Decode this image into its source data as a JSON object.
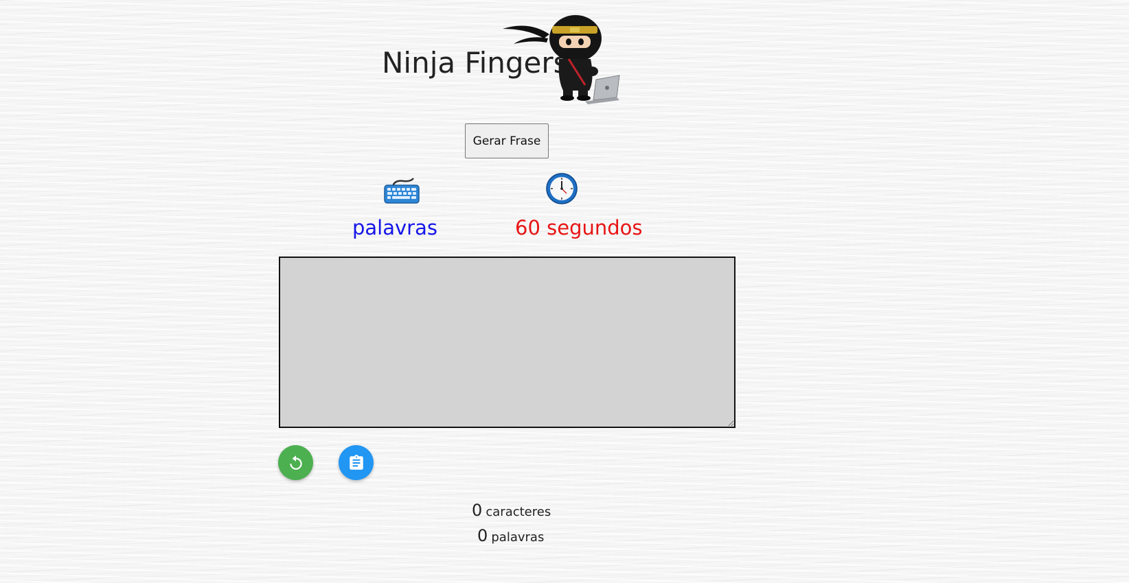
{
  "header": {
    "title": "Ninja Fingers",
    "logo_icon": "ninja-mascot-with-laptop"
  },
  "controls": {
    "generate_label": "Gerar Frase",
    "restart_icon": "restart-icon",
    "clipboard_icon": "clipboard-icon"
  },
  "stats": {
    "words_icon": "keyboard-icon",
    "words_label": "palavras",
    "timer_icon": "clock-icon",
    "timer_value": "60 segundos"
  },
  "typing_area": {
    "value": ""
  },
  "counters": {
    "characters_count": "0",
    "characters_label": "caracteres",
    "words_count": "0",
    "words_label": "palavras"
  },
  "colors": {
    "words_label": "#1515e8",
    "timer_label": "#e81515",
    "restart_button": "#4caf50",
    "clipboard_button": "#2196f3",
    "typing_area_bg": "#d3d3d3"
  }
}
